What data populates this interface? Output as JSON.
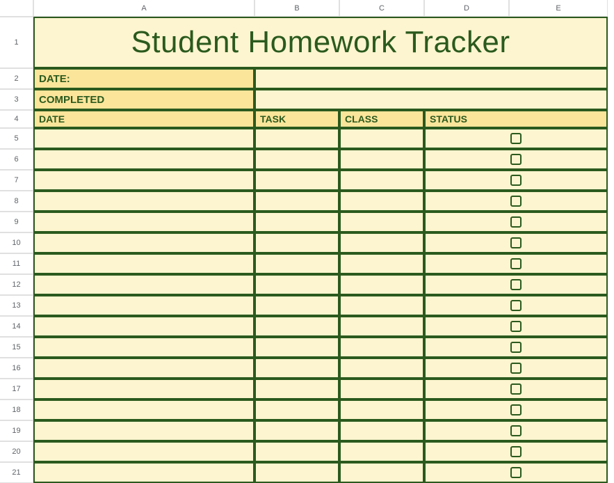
{
  "columns": [
    "A",
    "B",
    "C",
    "D",
    "E"
  ],
  "title": "Student Homework Tracker",
  "meta": {
    "date_label": "DATE:",
    "date_value": "",
    "completed_label": "COMPLETED",
    "completed_value": ""
  },
  "headers": {
    "date": "DATE",
    "task": "TASK",
    "class": "CLASS",
    "status": "STATUS"
  },
  "rows": [
    {
      "n": 5,
      "date": "",
      "task": "",
      "class": "",
      "status": false
    },
    {
      "n": 6,
      "date": "",
      "task": "",
      "class": "",
      "status": false
    },
    {
      "n": 7,
      "date": "",
      "task": "",
      "class": "",
      "status": false
    },
    {
      "n": 8,
      "date": "",
      "task": "",
      "class": "",
      "status": false
    },
    {
      "n": 9,
      "date": "",
      "task": "",
      "class": "",
      "status": false
    },
    {
      "n": 10,
      "date": "",
      "task": "",
      "class": "",
      "status": false
    },
    {
      "n": 11,
      "date": "",
      "task": "",
      "class": "",
      "status": false
    },
    {
      "n": 12,
      "date": "",
      "task": "",
      "class": "",
      "status": false
    },
    {
      "n": 13,
      "date": "",
      "task": "",
      "class": "",
      "status": false
    },
    {
      "n": 14,
      "date": "",
      "task": "",
      "class": "",
      "status": false
    },
    {
      "n": 15,
      "date": "",
      "task": "",
      "class": "",
      "status": false
    },
    {
      "n": 16,
      "date": "",
      "task": "",
      "class": "",
      "status": false
    },
    {
      "n": 17,
      "date": "",
      "task": "",
      "class": "",
      "status": false
    },
    {
      "n": 18,
      "date": "",
      "task": "",
      "class": "",
      "status": false
    },
    {
      "n": 19,
      "date": "",
      "task": "",
      "class": "",
      "status": false
    },
    {
      "n": 20,
      "date": "",
      "task": "",
      "class": "",
      "status": false
    },
    {
      "n": 21,
      "date": "",
      "task": "",
      "class": "",
      "status": false
    }
  ],
  "row_labels": {
    "title": "1",
    "meta_date": "2",
    "meta_completed": "3",
    "headers": "4"
  },
  "colors": {
    "dark_green": "#2b5a1e",
    "light_yellow": "#fdf5cf",
    "gold": "#fbe59b"
  }
}
